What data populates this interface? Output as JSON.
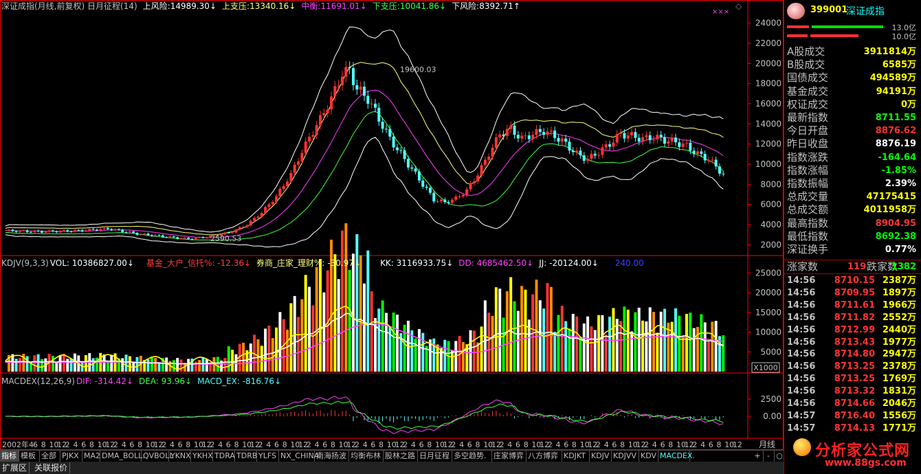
{
  "header": {
    "main_title": "深证成指(月线,前复权) 日月征程(14)",
    "upper_risk_label": "上风险:",
    "upper_risk_value": "14989.30",
    "upper_support_label": "上支压:",
    "upper_support_value": "13340.16",
    "middle_label": "中衡:",
    "middle_value": "11691.01",
    "lower_support_label": "下支压:",
    "lower_support_value": "10041.86",
    "lower_risk_label": "下风险:",
    "lower_risk_value": "8392.71",
    "high_annotation": "19600.03",
    "low_annotation": "2590.53",
    "marker": "×××"
  },
  "vol_header": {
    "title": "KDJV(9,3,3)",
    "vol_label": "VOL:",
    "vol_value": "10386827.00",
    "fund_label": "基金_大户_信托%:",
    "fund_value": "-12.36",
    "broker_label": "券商_庄家_理财%:",
    "broker_value": "-30.97",
    "kk_label": "KK:",
    "kk_value": "3116933.75",
    "dd_label": "DD:",
    "dd_value": "4685462.50",
    "jj_label": "JJ:",
    "jj_value": "-20124.00",
    "extra_value": "240.00"
  },
  "macd_header": {
    "title": "MACDEX(12,26,9)",
    "dif_label": "DIF:",
    "dif_value": "-314.42",
    "dea_label": "DEA:",
    "dea_value": "93.96",
    "ex_label": "MACD_EX:",
    "ex_value": "-816.76"
  },
  "price_axis": [
    "24000",
    "22000",
    "20000",
    "18000",
    "16000",
    "14000",
    "12000",
    "10000",
    "8000",
    "6000",
    "4000",
    "2000"
  ],
  "vol_axis": [
    "25000",
    "20000",
    "15000",
    "10000",
    "5000"
  ],
  "vol_unit": "X1000",
  "macd_axis": [
    "2500",
    "0.00"
  ],
  "time_axis": [
    "2002年4",
    "6",
    "8",
    "10",
    "12",
    "2",
    "4",
    "6",
    "8",
    "10",
    "12",
    "2",
    "4",
    "6",
    "8",
    "10",
    "12",
    "2",
    "4",
    "6",
    "8",
    "10",
    "12",
    "2",
    "4",
    "6",
    "8",
    "10",
    "12",
    "2",
    "4",
    "6",
    "8",
    "10",
    "12",
    "2",
    "4",
    "6",
    "8",
    "10",
    "12",
    "2",
    "4",
    "6",
    "8",
    "10",
    "12",
    "2",
    "4",
    "6",
    "8",
    "10",
    "12",
    "2",
    "4",
    "6",
    "8",
    "10",
    "12",
    "2",
    "4",
    "6",
    "8",
    "10",
    "12",
    "2",
    "4",
    "6",
    "8",
    "10",
    "12",
    "2",
    "4",
    "6",
    "8",
    "10",
    "12",
    "2",
    "4",
    "6",
    "8",
    "10",
    "12",
    "2",
    "4",
    "6",
    "8",
    "10",
    "12"
  ],
  "period_label": "月线",
  "tabs": [
    "指标",
    "模板",
    "全部",
    "PJKX",
    "MA2",
    "DMA_BOLL.",
    "QVBOLL",
    "YKNX",
    "YKHX",
    "TDRA",
    "TDRB",
    "YLFS",
    "NX_CHINA",
    "南海扬波",
    "均衡布林",
    "股林之路",
    "日月征程",
    "多空趋势.",
    "庄家博弈",
    "八方博弈",
    "KDJKT",
    "KDJV",
    "KDJVV",
    "KDV",
    "MACDEX."
  ],
  "tab_controls": [
    "+",
    "-",
    "○"
  ],
  "tabs2": [
    "扩展区",
    "关联报价"
  ],
  "panel": {
    "code": "399001",
    "name": "深证成指",
    "bar1_label": "13.0亿",
    "bar2_label": "10.0亿",
    "rows": [
      {
        "label": "A股成交",
        "value": "3911814万",
        "color": "#ffff00"
      },
      {
        "label": "B股成交",
        "value": "6585万",
        "color": "#ffff00"
      },
      {
        "label": "国债成交",
        "value": "494589万",
        "color": "#ffff00"
      },
      {
        "label": "基金成交",
        "value": "94191万",
        "color": "#ffff00"
      },
      {
        "label": "权证成交",
        "value": "0万",
        "color": "#ffff00"
      },
      {
        "label": "最新指数",
        "value": "8711.55",
        "color": "#00ff00"
      },
      {
        "label": "今日开盘",
        "value": "8876.62",
        "color": "#ff3333"
      },
      {
        "label": "昨日收盘",
        "value": "8876.19",
        "color": "#ffffff"
      },
      {
        "label": "指数涨跌",
        "value": "-164.64",
        "color": "#00ff00"
      },
      {
        "label": "指数涨幅",
        "value": "-1.85%",
        "color": "#00ff00"
      },
      {
        "label": "指数振幅",
        "value": "2.39%",
        "color": "#ffffff"
      },
      {
        "label": "总成交量",
        "value": "47175415",
        "color": "#ffff00"
      },
      {
        "label": "总成交额",
        "value": "4011958万",
        "color": "#ffff00"
      },
      {
        "label": "最高指数",
        "value": "8904.95",
        "color": "#ff3333"
      },
      {
        "label": "最低指数",
        "value": "8692.38",
        "color": "#00ff00"
      },
      {
        "label": "深证换手",
        "value": "0.77%",
        "color": "#ffffff"
      }
    ],
    "up_label": "涨家数",
    "up_value": "119",
    "down_label": "跌家数",
    "down_value": "1382",
    "ticks": [
      {
        "t": "14:56",
        "p": "8710.15",
        "v": "2387万"
      },
      {
        "t": "14:56",
        "p": "8709.95",
        "v": "1897万"
      },
      {
        "t": "14:56",
        "p": "8711.61",
        "v": "1966万"
      },
      {
        "t": "14:56",
        "p": "8711.82",
        "v": "2552万"
      },
      {
        "t": "14:56",
        "p": "8712.99",
        "v": "2440万"
      },
      {
        "t": "14:56",
        "p": "8713.43",
        "v": "1977万"
      },
      {
        "t": "14:56",
        "p": "8714.80",
        "v": "2947万"
      },
      {
        "t": "14:56",
        "p": "8713.25",
        "v": "2378万"
      },
      {
        "t": "14:56",
        "p": "8713.25",
        "v": "1769万"
      },
      {
        "t": "14:56",
        "p": "8713.32",
        "v": "1831万"
      },
      {
        "t": "14:56",
        "p": "8714.66",
        "v": "2046万"
      },
      {
        "t": "14:57",
        "p": "8716.40",
        "v": "1556万"
      },
      {
        "t": "14:57",
        "p": "8714.13",
        "v": "1771万"
      }
    ]
  },
  "watermark": {
    "text": "分析家公式网",
    "url": "www.88gs.com"
  },
  "colors": {
    "up": "#ff3333",
    "down": "#54fcfc",
    "axis": "#ff0000",
    "band_outer": "#ffffff",
    "band_upper": "#ffff80",
    "band_mid": "#ff40ff",
    "band_lower": "#40ff40"
  }
}
